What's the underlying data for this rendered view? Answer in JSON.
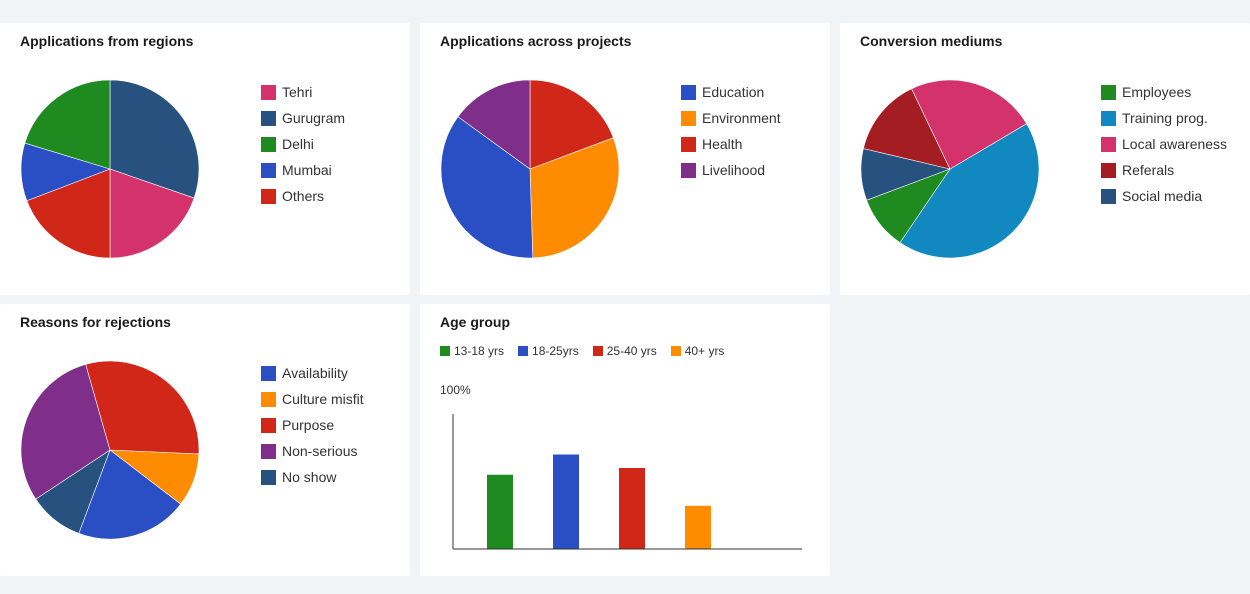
{
  "colors": {
    "green": "#1f8a1f",
    "blue": "#2a4fc4",
    "red": "#d02719",
    "orange": "#ff8c00",
    "purple": "#7f2e8a",
    "pink": "#d3326a",
    "navy": "#27527f",
    "teal": "#1188c0",
    "maroon": "#a31d23"
  },
  "cards": {
    "regions": {
      "title": "Applications from regions",
      "chart_data": {
        "type": "pie",
        "title": "Applications from regions",
        "series": [
          {
            "name": "Tehri",
            "value": 19.7,
            "color": "#d3326a"
          },
          {
            "name": "Gurugram",
            "value": 30.3,
            "color": "#27527f"
          },
          {
            "name": "Delhi",
            "value": 20.3,
            "color": "#1f8a1f"
          },
          {
            "name": "Mumbai",
            "value": 10.5,
            "color": "#2a4fc4"
          },
          {
            "name": "Others",
            "value": 19.2,
            "color": "#d02719"
          }
        ],
        "slice_order": [
          "Gurugram",
          "Tehri",
          "Others",
          "Mumbai",
          "Delhi"
        ],
        "legend_position": "right"
      }
    },
    "projects": {
      "title": "Applications across projects",
      "chart_data": {
        "type": "pie",
        "title": "Applications across projects",
        "series": [
          {
            "name": "Education",
            "value": 35.5,
            "color": "#2a4fc4"
          },
          {
            "name": "Environment",
            "value": 30.2,
            "color": "#ff8c00"
          },
          {
            "name": "Health",
            "value": 19.3,
            "color": "#d02719"
          },
          {
            "name": "Livelihood",
            "value": 15.0,
            "color": "#7f2e8a"
          }
        ],
        "slice_order": [
          "Health",
          "Environment",
          "Education",
          "Livelihood"
        ],
        "legend_position": "right"
      }
    },
    "conversion": {
      "title": "Conversion mediums",
      "chart_data": {
        "type": "pie",
        "title": "Conversion mediums",
        "series": [
          {
            "name": "Employees",
            "value": 9.8,
            "color": "#1f8a1f"
          },
          {
            "name": "Training prog.",
            "value": 43.0,
            "color": "#1188c0"
          },
          {
            "name": "Local awareness",
            "value": 23.6,
            "color": "#d3326a"
          },
          {
            "name": "Referals",
            "value": 14.2,
            "color": "#a31d23"
          },
          {
            "name": "Social media",
            "value": 9.4,
            "color": "#27527f"
          }
        ],
        "slice_order": [
          "Training prog.",
          "Employees",
          "Social media",
          "Referals",
          "Local awareness"
        ],
        "start_value_offset": 16.5,
        "legend_position": "right"
      }
    },
    "rejections": {
      "title": "Reasons for rejections",
      "chart_data": {
        "type": "pie",
        "title": "Reasons for rejections",
        "series": [
          {
            "name": "Availability",
            "value": 20.3,
            "color": "#2a4fc4"
          },
          {
            "name": "Culture misfit",
            "value": 9.7,
            "color": "#ff8c00"
          },
          {
            "name": "Purpose",
            "value": 30.1,
            "color": "#d02719"
          },
          {
            "name": "Non-serious",
            "value": 29.9,
            "color": "#7f2e8a"
          },
          {
            "name": "No show",
            "value": 10.0,
            "color": "#27527f"
          }
        ],
        "slice_order": [
          "Culture misfit",
          "Availability",
          "No show",
          "Non-serious",
          "Purpose"
        ],
        "start_value_offset": 25.7,
        "legend_position": "right"
      }
    },
    "age": {
      "title": "Age group",
      "ymax_label": "100%",
      "chart_data": {
        "type": "bar",
        "title": "Age group",
        "categories": [
          "13-18 yrs",
          "18-25yrs",
          "25-40 yrs",
          "40+ yrs"
        ],
        "series": [
          {
            "name": "13-18 yrs",
            "values": [
              55
            ],
            "color": "#1f8a1f"
          },
          {
            "name": "18-25yrs",
            "values": [
              70
            ],
            "color": "#2a4fc4"
          },
          {
            "name": "25-40 yrs",
            "values": [
              60
            ],
            "color": "#d02719"
          },
          {
            "name": "40+ yrs",
            "values": [
              32
            ],
            "color": "#ff8c00"
          }
        ],
        "ylim": [
          0,
          100
        ],
        "xlabel": "",
        "ylabel": "",
        "legend_position": "top-left"
      }
    }
  }
}
